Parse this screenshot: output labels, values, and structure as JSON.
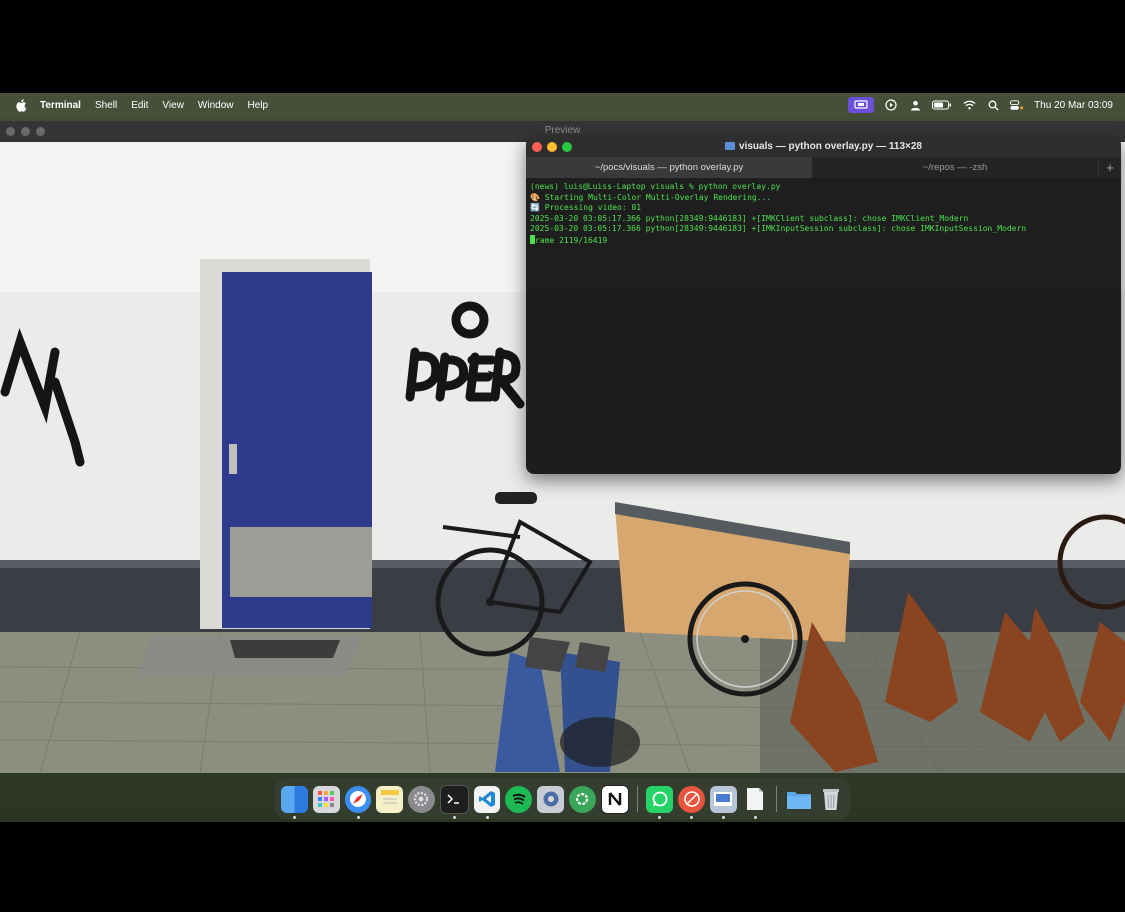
{
  "menubar": {
    "app_name": "Terminal",
    "items": [
      "Shell",
      "Edit",
      "View",
      "Window",
      "Help"
    ],
    "clock": "Thu 20 Mar  03:09",
    "icons": [
      "screen-mirroring-icon",
      "play-icon",
      "user-icon",
      "battery-icon",
      "wifi-icon",
      "search-icon",
      "control-center-icon"
    ]
  },
  "preview": {
    "title": "Preview"
  },
  "terminal": {
    "title": "visuals — python overlay.py — 113×28",
    "tabs": [
      {
        "label": "~/pocs/visuals — python overlay.py",
        "active": true
      },
      {
        "label": "~/repos — -zsh",
        "active": false
      }
    ],
    "new_tab": "+",
    "lines": [
      "(news) luis@Luiss-Laptop visuals % python overlay.py",
      "🎨 Starting Multi-Color Multi-Overlay Rendering...",
      "🔄 Processing video: 01",
      "2025-03-20 03:05:17.366 python[28349:9446183] +[IMKClient subclass]: chose IMKClient_Modern",
      "2025-03-20 03:05:17.366 python[28349:9446183] +[IMKInputSession subclass]: chose IMKInputSession_Modern"
    ],
    "progress_line": "rame 2119/16419"
  },
  "dock": {
    "apps": [
      "finder",
      "launchpad",
      "safari",
      "notes",
      "system-settings",
      "terminal",
      "vscode",
      "spotify",
      "disk-utility",
      "chatgpt",
      "notion",
      "whatsapp",
      "digital-color-meter",
      "preview",
      "textedit",
      "downloads-folder",
      "trash"
    ]
  },
  "colors": {
    "terminal_text": "#4ee04e",
    "menubar_active": "#6a4fd8"
  }
}
